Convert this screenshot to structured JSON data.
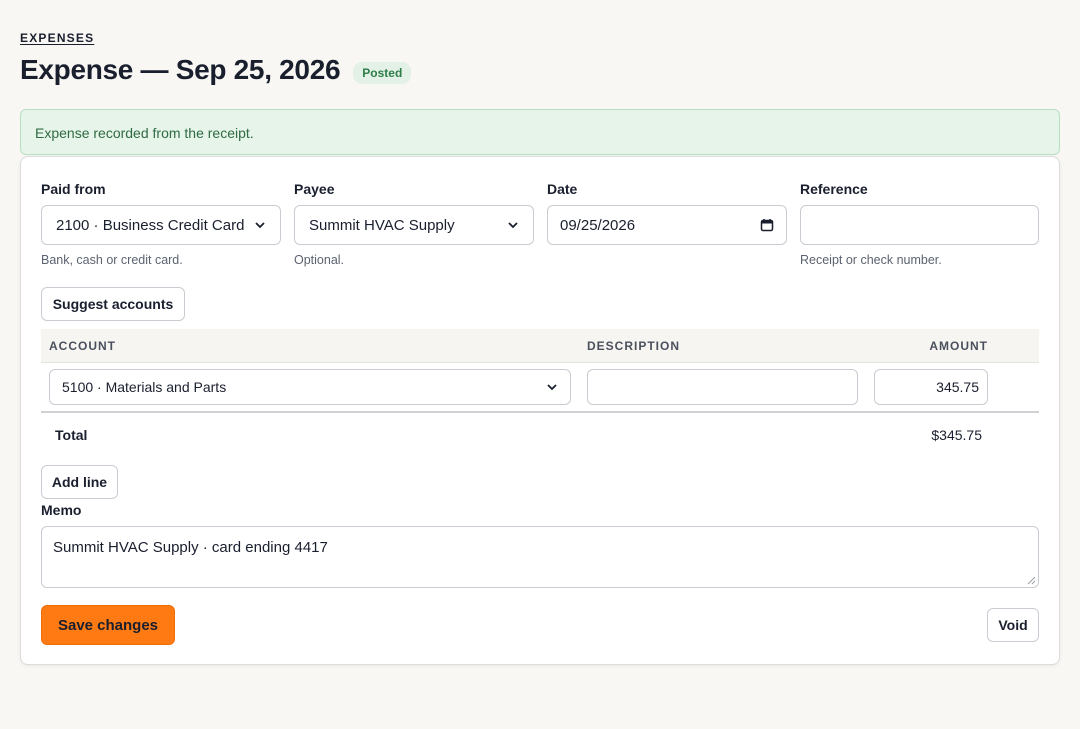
{
  "breadcrumb": "EXPENSES",
  "header": {
    "title": "Expense — Sep 25, 2026",
    "status": "Posted"
  },
  "alert": "Expense recorded from the receipt.",
  "form": {
    "paid_from": {
      "label": "Paid from",
      "value": "2100 · Business Credit Card",
      "help": "Bank, cash or credit card."
    },
    "payee": {
      "label": "Payee",
      "value": "Summit HVAC Supply",
      "help": "Optional."
    },
    "date": {
      "label": "Date",
      "value": "09/25/2026"
    },
    "reference": {
      "label": "Reference",
      "value": "",
      "help": "Receipt or check number."
    }
  },
  "suggest_label": "Suggest accounts",
  "table": {
    "headers": {
      "account": "ACCOUNT",
      "description": "DESCRIPTION",
      "amount": "AMOUNT"
    },
    "lines": [
      {
        "account": "5100 · Materials and Parts",
        "description": "",
        "amount": "345.75"
      }
    ],
    "total_label": "Total",
    "total_value": "$345.75"
  },
  "add_line_label": "Add line",
  "memo": {
    "label": "Memo",
    "value": "Summit HVAC Supply · card ending 4417"
  },
  "actions": {
    "save": "Save changes",
    "void": "Void"
  }
}
